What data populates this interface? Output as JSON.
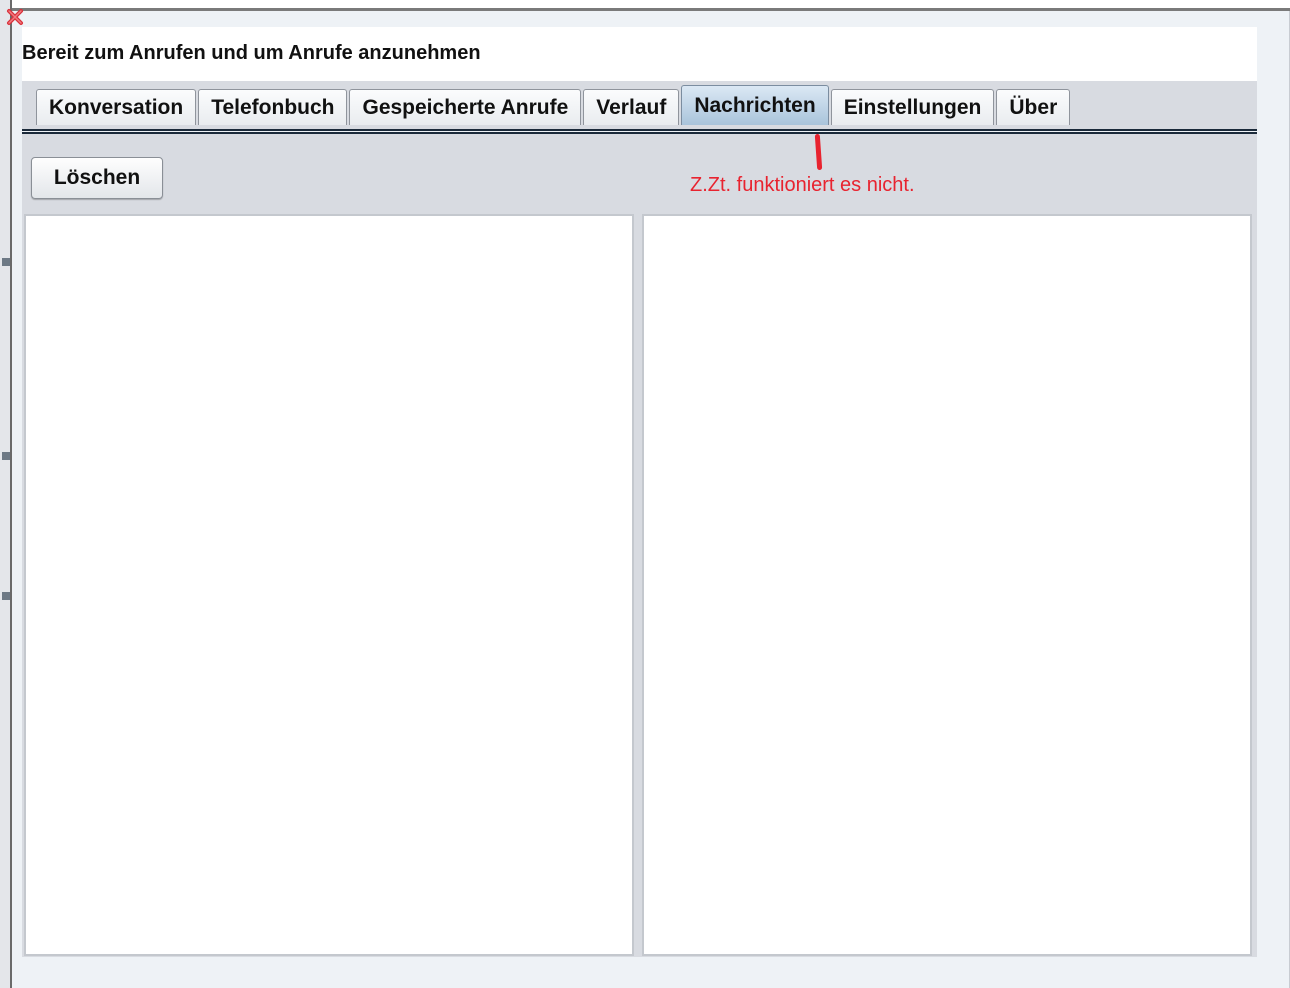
{
  "status": {
    "text": "Bereit zum Anrufen und um Anrufe anzunehmen"
  },
  "tabs": [
    {
      "label": "Konversation",
      "active": false
    },
    {
      "label": "Telefonbuch",
      "active": false
    },
    {
      "label": "Gespeicherte Anrufe",
      "active": false
    },
    {
      "label": "Verlauf",
      "active": false
    },
    {
      "label": "Nachrichten",
      "active": true
    },
    {
      "label": "Einstellungen",
      "active": false
    },
    {
      "label": "Über",
      "active": false
    }
  ],
  "toolbar": {
    "delete_label": "Löschen"
  },
  "annotation": {
    "text": "Z.Zt. funktioniert es nicht.",
    "color": "#e8232f"
  },
  "icons": {
    "close": "close-icon"
  },
  "colors": {
    "content_bg": "#d8dbe1",
    "active_tab": "#a9c4db"
  }
}
